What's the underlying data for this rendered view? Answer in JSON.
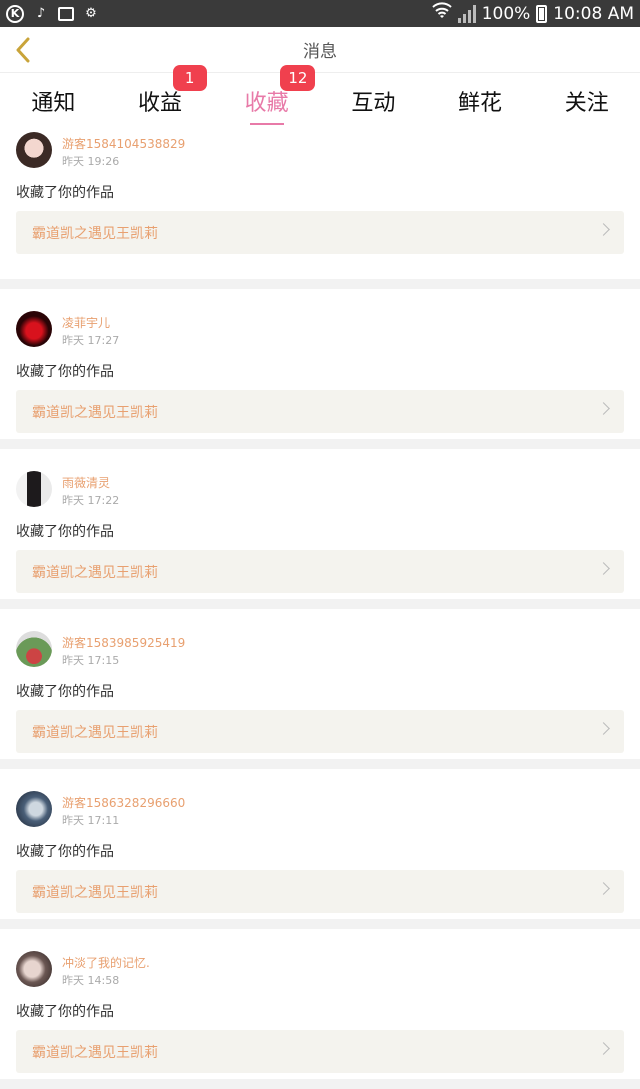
{
  "status_bar": {
    "battery": "100%",
    "time": "10:08 AM"
  },
  "header": {
    "title": "消息"
  },
  "tabs": [
    {
      "label": "通知",
      "badge": ""
    },
    {
      "label": "收益",
      "badge": "1"
    },
    {
      "label": "收藏",
      "badge": "12",
      "active": true
    },
    {
      "label": "互动",
      "badge": ""
    },
    {
      "label": "鲜花",
      "badge": ""
    },
    {
      "label": "关注",
      "badge": ""
    }
  ],
  "colors": {
    "accent": "#e87aa8",
    "username": "#e8a070",
    "badge": "#f0404e"
  },
  "items": [
    {
      "user": "游客15841045388​29",
      "time": "昨天 19:26",
      "action": "收藏了你的作品",
      "work": "霸道凯之遇见王凯莉"
    },
    {
      "user": "凌菲宇儿",
      "time": "昨天 17:27",
      "action": "收藏了你的作品",
      "work": "霸道凯之遇见王凯莉"
    },
    {
      "user": "雨薇清灵",
      "time": "昨天 17:22",
      "action": "收藏了你的作品",
      "work": "霸道凯之遇见王凯莉"
    },
    {
      "user": "游客1583985925419",
      "time": "昨天 17:15",
      "action": "收藏了你的作品",
      "work": "霸道凯之遇见王凯莉"
    },
    {
      "user": "游客1586328296660",
      "time": "昨天 17:11",
      "action": "收藏了你的作品",
      "work": "霸道凯之遇见王凯莉"
    },
    {
      "user": "冲淡了我的记忆.",
      "time": "昨天 14:58",
      "action": "收藏了你的作品",
      "work": "霸道凯之遇见王凯莉"
    }
  ]
}
